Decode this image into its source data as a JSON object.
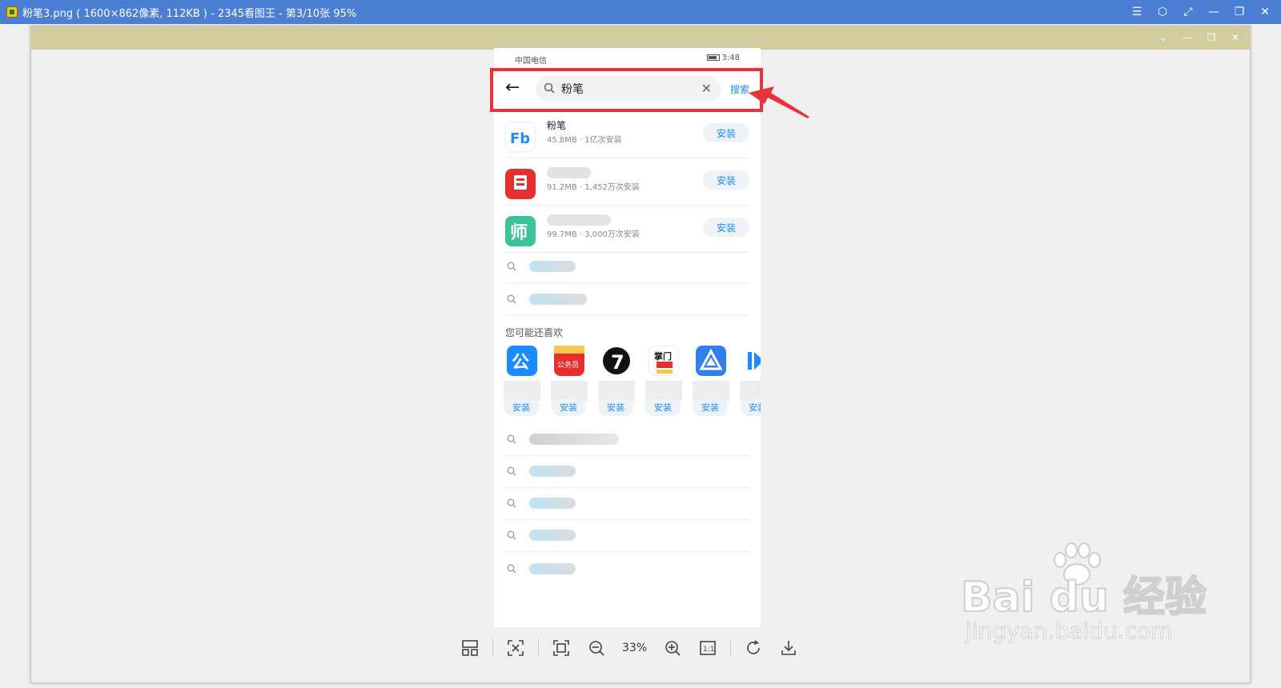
{
  "window": {
    "title": "粉笔3.png ( 1600×862像素, 112KB ) - 2345看图王 - 第3/10张 95%"
  },
  "phone": {
    "status": {
      "carrier": "中国电信",
      "time": "3:48"
    },
    "search": {
      "value": "粉笔",
      "button_label": "搜索"
    },
    "apps": [
      {
        "name": "粉笔",
        "meta": "45.8MB · 1亿次安装",
        "install_label": "安装",
        "icon_color": "#1a8cff"
      },
      {
        "name": "",
        "meta": "91.2MB · 1,452万次安装",
        "install_label": "安装",
        "icon_color": "#e6302f"
      },
      {
        "name": "",
        "meta": "99.7MB · 3,000万次安装",
        "install_label": "安装",
        "icon_color": "#3cc39a"
      }
    ],
    "section_title": "您可能还喜欢",
    "recommended": [
      {
        "icon_text": "公",
        "install_label": "安装",
        "icon_color": "#1a8cff"
      },
      {
        "icon_text": "公务员",
        "install_label": "安装",
        "icon_color": "#e6302f"
      },
      {
        "icon_text": "7",
        "install_label": "安装",
        "icon_color": "#111111"
      },
      {
        "icon_text": "掌门",
        "install_label": "安装",
        "icon_color": "#f2c94c"
      },
      {
        "icon_text": "",
        "install_label": "安装",
        "icon_color": "#2f80ed"
      },
      {
        "icon_text": "",
        "install_label": "安装",
        "icon_color": "#1a8cff"
      }
    ]
  },
  "toolbar": {
    "zoom": "33%"
  },
  "watermark": {
    "main": "Bai du 经验",
    "sub": "jingyan.baidu.com"
  },
  "colors": {
    "titlebar": "#4a7fd3",
    "accent": "#1a8cff",
    "highlight": "#e8333a"
  }
}
